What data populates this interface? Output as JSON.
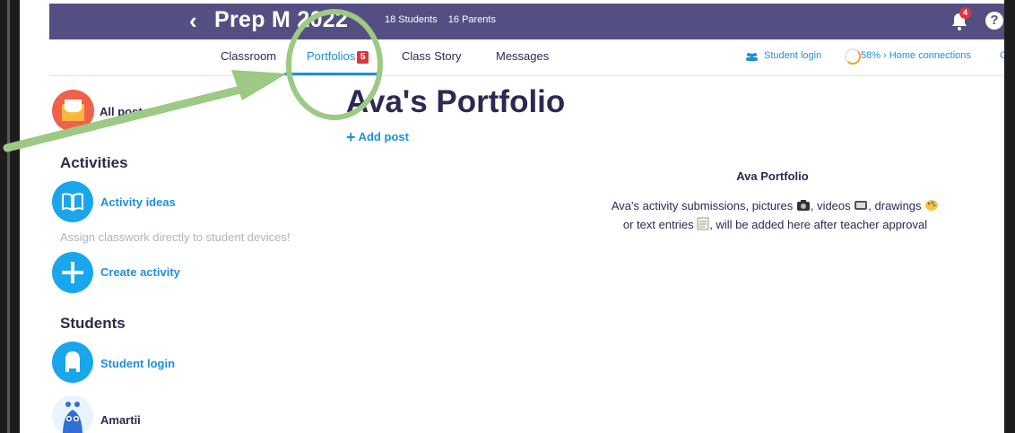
{
  "header": {
    "back_icon": "chevron-left-icon",
    "class_name": "Prep M 2022",
    "students_count": "18 Students",
    "parents_count": "16 Parents",
    "notification_count": "4",
    "help_label": "?"
  },
  "nav": {
    "tabs": [
      {
        "label": "Classroom",
        "active": false
      },
      {
        "label": "Portfolios",
        "badge": "5",
        "active": true
      },
      {
        "label": "Class Story",
        "active": false
      },
      {
        "label": "Messages",
        "active": false
      }
    ],
    "student_login": "Student login",
    "home_connections": "58% › Home connections",
    "overflow_label": "O"
  },
  "sidebar": {
    "all_posts": "All posts",
    "activities_heading": "Activities",
    "activity_ideas": "Activity ideas",
    "assign_hint": "Assign classwork directly to student devices!",
    "create_activity": "Create activity",
    "students_heading": "Students",
    "student_login": "Student login",
    "student_name": "Amartii"
  },
  "main": {
    "title": "Ava's Portfolio",
    "add_post": "Add post",
    "empty_title": "Ava Portfolio",
    "empty_line1_a": "Ava's activity submissions, pictures",
    "empty_line1_b": ", videos",
    "empty_line1_c": ", drawings",
    "empty_line2_a": "or text entries",
    "empty_line2_b": ", will be added here after teacher approval"
  },
  "colors": {
    "header_bg": "#544f82",
    "accent": "#1e8fde",
    "badge": "#e03540",
    "annotation": "#9cc983"
  },
  "annotations": {
    "arrow": "green-arrow-icon",
    "circle": "green-circle-highlight"
  }
}
